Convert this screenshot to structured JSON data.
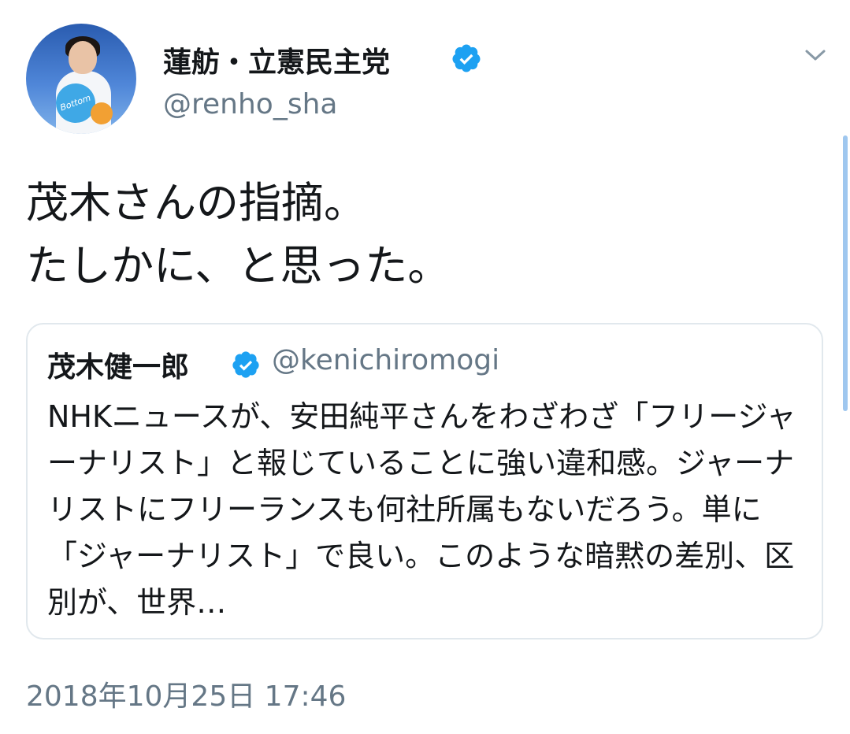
{
  "author": {
    "display_name": "蓮舫・立憲民主党",
    "handle": "@renho_sha",
    "avatar_badge_text": "Bottom up"
  },
  "tweet": {
    "text": "茂木さんの指摘。\nたしかに、と思った。",
    "timestamp": "2018年10月25日 17:46"
  },
  "quoted_tweet": {
    "display_name": "茂木健一郎",
    "handle": "@kenichiromogi",
    "text": "NHKニュースが、安田純平さんをわざわざ「フリージャーナリスト」と報じていることに強い違和感。ジャーナリストにフリーランスも何社所属もないだろう。単に「ジャーナリスト」で良い。このような暗黙の差別、区別が、世界…"
  },
  "icons": {
    "verified": "verified-badge-icon",
    "menu": "chevron-down-icon"
  },
  "colors": {
    "verified": "#1da1f2",
    "secondary_text": "#657786",
    "border": "#e1e8ed",
    "scrollbar": "#9fc7ef"
  }
}
